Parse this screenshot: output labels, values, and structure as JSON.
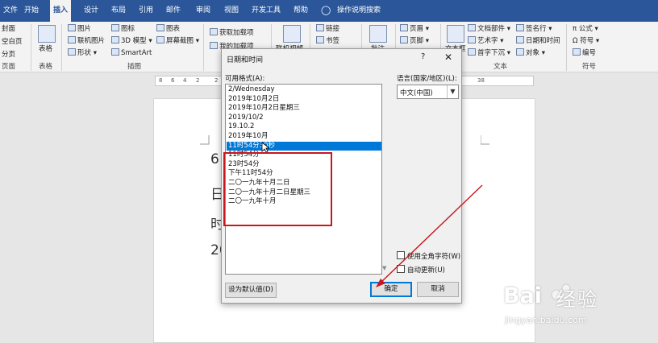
{
  "ribbon_tabs": [
    "文件",
    "开始",
    "插入",
    "设计",
    "布局",
    "引用",
    "邮件",
    "审阅",
    "视图",
    "开发工具",
    "帮助",
    "操作说明搜索"
  ],
  "ribbon": {
    "pages": [
      "封面",
      "空白页",
      "分页"
    ],
    "pages_group": "页面",
    "table": "表格",
    "table_group": "表格",
    "illus": [
      "图片",
      "联机图片",
      "形状",
      "图标",
      "3D 模型",
      "SmartArt",
      "图表",
      "屏幕截图"
    ],
    "illus_group": "插图",
    "addins": [
      "获取加载项",
      "我的加载项"
    ],
    "online_video": "联机视频",
    "links": [
      "链接",
      "书签"
    ],
    "comment": "批注",
    "header_footer": [
      "页眉",
      "页脚",
      "页码"
    ],
    "textbox": "文本框",
    "text_items": [
      "文档部件",
      "艺术字",
      "首字下沉",
      "签名行",
      "日期和时间",
      "对象"
    ],
    "text_group": "文本",
    "symbols": [
      "公式",
      "符号",
      "编号"
    ],
    "symbols_group": "符号"
  },
  "ruler": {
    "left_numbers": [
      "8",
      "6",
      "4",
      "2",
      "2"
    ],
    "right_number": "38"
  },
  "document": {
    "chars": [
      "6",
      "日",
      "时",
      "20"
    ]
  },
  "dialog": {
    "title": "日期和时间",
    "help": "?",
    "close": "✕",
    "formats_label": "可用格式(A):",
    "formats": [
      "2/Wednesday",
      "2019年10月2日",
      "2019年10月2日星期三",
      "2019/10/2",
      "19.10.2",
      "2019年10月",
      "11时54分30秒",
      "11时54分",
      "23时54分",
      "下午11时54分",
      "二〇一九年十月二日",
      "二〇一九年十月二日星期三",
      "二〇一九年十月"
    ],
    "selected_index": 6,
    "language_label": "语言(国家/地区)(L):",
    "language_value": "中文(中国)",
    "fullwidth_label": "使用全角字符(W)",
    "autoupdate_label": "自动更新(U)",
    "set_default": "设为默认值(D)",
    "ok": "确定",
    "cancel": "取消"
  },
  "watermark": {
    "brand": "Bai",
    "cn": "经验",
    "url": "jingyan.baidu.com"
  },
  "colors": {
    "ribbon_blue": "#2b579a",
    "selection": "#0078d7",
    "annotation_red": "#c8171d"
  }
}
